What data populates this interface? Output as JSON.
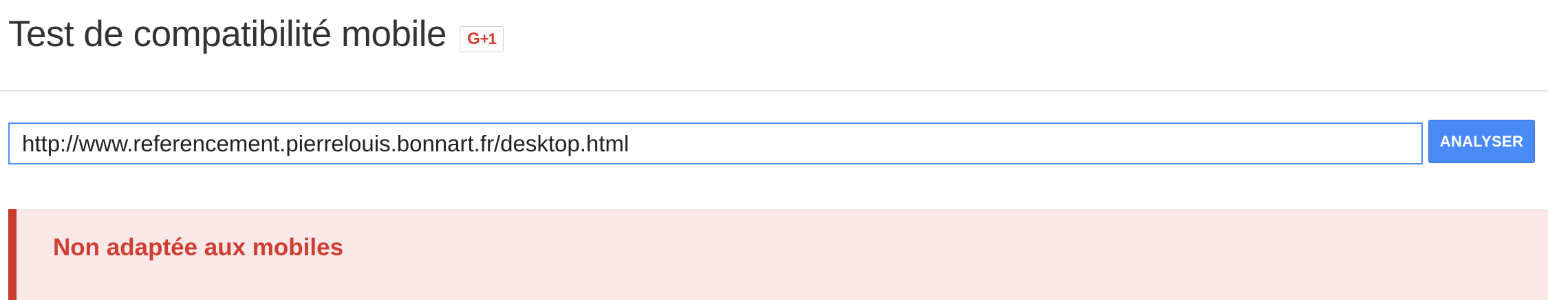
{
  "header": {
    "title": "Test de compatibilité mobile",
    "gplus_label": "G",
    "gplus_count": "+1"
  },
  "search": {
    "url_value": "http://www.referencement.pierrelouis.bonnart.fr/desktop.html",
    "submit_label": "ANALYSER"
  },
  "result": {
    "status_text": "Non adaptée aux mobiles",
    "status_color": "#cf3e33",
    "banner_background": "#f9e8e7"
  },
  "colors": {
    "accent": "#4a8af4",
    "input_focus_border": "#4d90fe",
    "error": "#cc3b30"
  }
}
